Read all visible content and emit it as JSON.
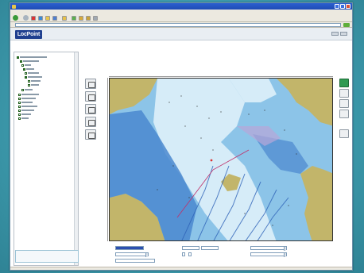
{
  "browser": {
    "window_title": "",
    "menu_items": [
      "",
      "",
      "",
      "",
      "",
      ""
    ],
    "toolbar_labels": [
      "",
      "",
      "",
      ""
    ],
    "address_label": "",
    "address_url": ""
  },
  "app": {
    "logo_text": "LocPoint",
    "brand_text": ""
  },
  "sidebar": {
    "scrollable": true
  },
  "map": {
    "kind": "nautical chart",
    "colors": {
      "land": "#c2b56a",
      "deep_water": "#3a78c6",
      "mid_water": "#8cc4e8",
      "shallow_water": "#d6ecf8",
      "frame": "#333333"
    }
  },
  "form": {
    "labels": [
      "",
      "",
      "",
      "",
      "",
      "",
      "",
      ""
    ],
    "values": [
      "",
      "",
      "",
      "",
      "",
      ""
    ],
    "checkbox_labels": [
      "",
      ""
    ],
    "submit_label": ""
  },
  "colors": {
    "titlebar": "#2b5fd0",
    "logo_bg": "#1f3f8f",
    "backdrop": "#3f9fb0"
  }
}
